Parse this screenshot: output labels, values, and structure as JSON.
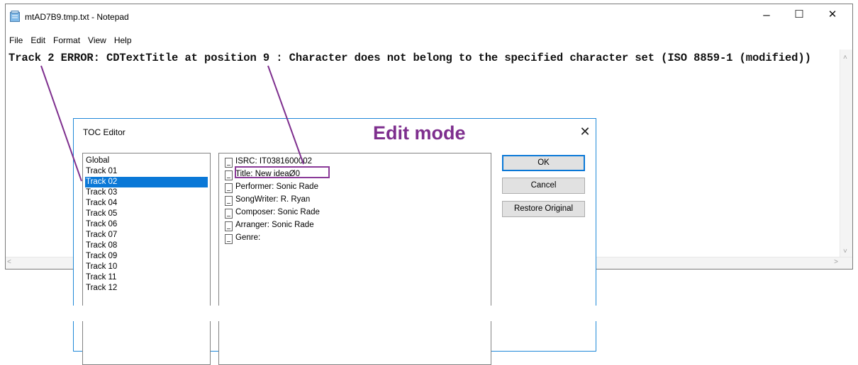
{
  "notepad": {
    "title": "mtAD7B9.tmp.txt - Notepad",
    "minimize": "–",
    "maximize": "☐",
    "close": "✕",
    "menu": [
      "File",
      "Edit",
      "Format",
      "View",
      "Help"
    ],
    "content": "Track 2 ERROR: CDTextTitle at position 9 : Character does not belong to the specified character set (ISO 8859-1 (modified))",
    "scroll_up": "˄",
    "scroll_down": "˅",
    "scroll_left": "˂",
    "scroll_right": "˃"
  },
  "dialog": {
    "title": "TOC Editor",
    "close": "✕",
    "annotation": "Edit mode",
    "tracks": [
      "Global",
      "Track 01",
      "Track 02",
      "Track 03",
      "Track 04",
      "Track 05",
      "Track 06",
      "Track 07",
      "Track 08",
      "Track 09",
      "Track 10",
      "Track 11",
      "Track 12"
    ],
    "selected_track": "Track 02",
    "properties": [
      "ISRC: IT0381600002",
      "Title: New ideaØ0",
      "Performer: Sonic Rade",
      "SongWriter: R. Ryan",
      "Composer: Sonic Rade",
      "Arranger: Sonic Rade",
      "Genre:"
    ],
    "buttons": {
      "ok": "OK",
      "cancel": "Cancel",
      "restore": "Restore Original"
    }
  },
  "colors": {
    "annotation": "#7e2f8e",
    "selection": "#0a78d7",
    "dialog_border": "#1f88d8"
  }
}
